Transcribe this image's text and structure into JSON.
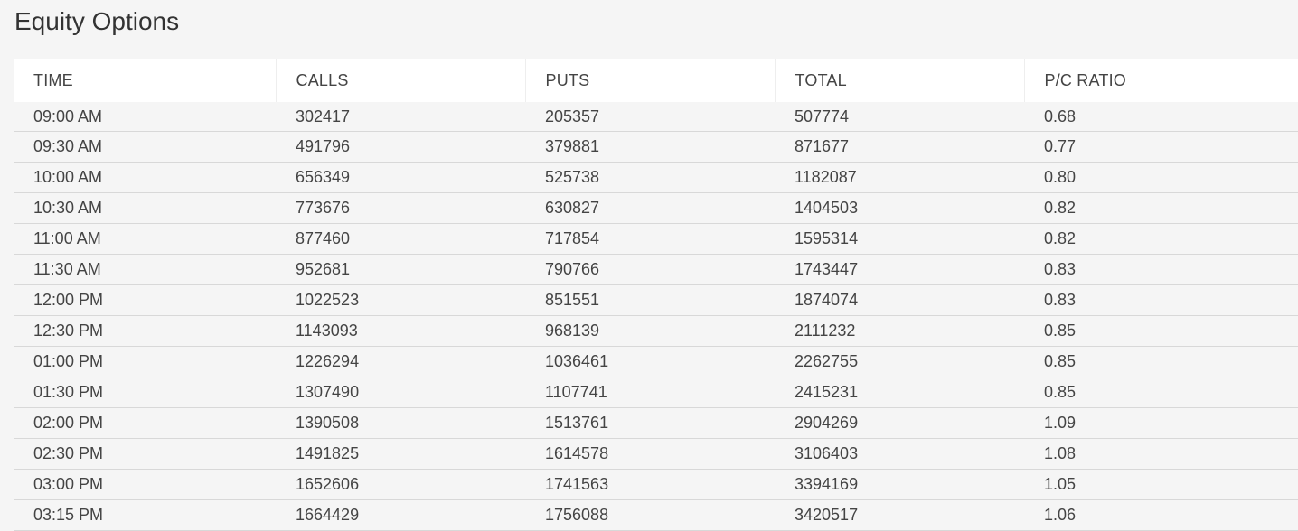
{
  "page": {
    "title": "Equity Options"
  },
  "table": {
    "headers": [
      "TIME",
      "CALLS",
      "PUTS",
      "TOTAL",
      "P/C RATIO"
    ],
    "rows": [
      [
        "09:00 AM",
        "302417",
        "205357",
        "507774",
        "0.68"
      ],
      [
        "09:30 AM",
        "491796",
        "379881",
        "871677",
        "0.77"
      ],
      [
        "10:00 AM",
        "656349",
        "525738",
        "1182087",
        "0.80"
      ],
      [
        "10:30 AM",
        "773676",
        "630827",
        "1404503",
        "0.82"
      ],
      [
        "11:00 AM",
        "877460",
        "717854",
        "1595314",
        "0.82"
      ],
      [
        "11:30 AM",
        "952681",
        "790766",
        "1743447",
        "0.83"
      ],
      [
        "12:00 PM",
        "1022523",
        "851551",
        "1874074",
        "0.83"
      ],
      [
        "12:30 PM",
        "1143093",
        "968139",
        "2111232",
        "0.85"
      ],
      [
        "01:00 PM",
        "1226294",
        "1036461",
        "2262755",
        "0.85"
      ],
      [
        "01:30 PM",
        "1307490",
        "1107741",
        "2415231",
        "0.85"
      ],
      [
        "02:00 PM",
        "1390508",
        "1513761",
        "2904269",
        "1.09"
      ],
      [
        "02:30 PM",
        "1491825",
        "1614578",
        "3106403",
        "1.08"
      ],
      [
        "03:00 PM",
        "1652606",
        "1741563",
        "3394169",
        "1.05"
      ],
      [
        "03:15 PM",
        "1664429",
        "1756088",
        "3420517",
        "1.06"
      ]
    ]
  }
}
